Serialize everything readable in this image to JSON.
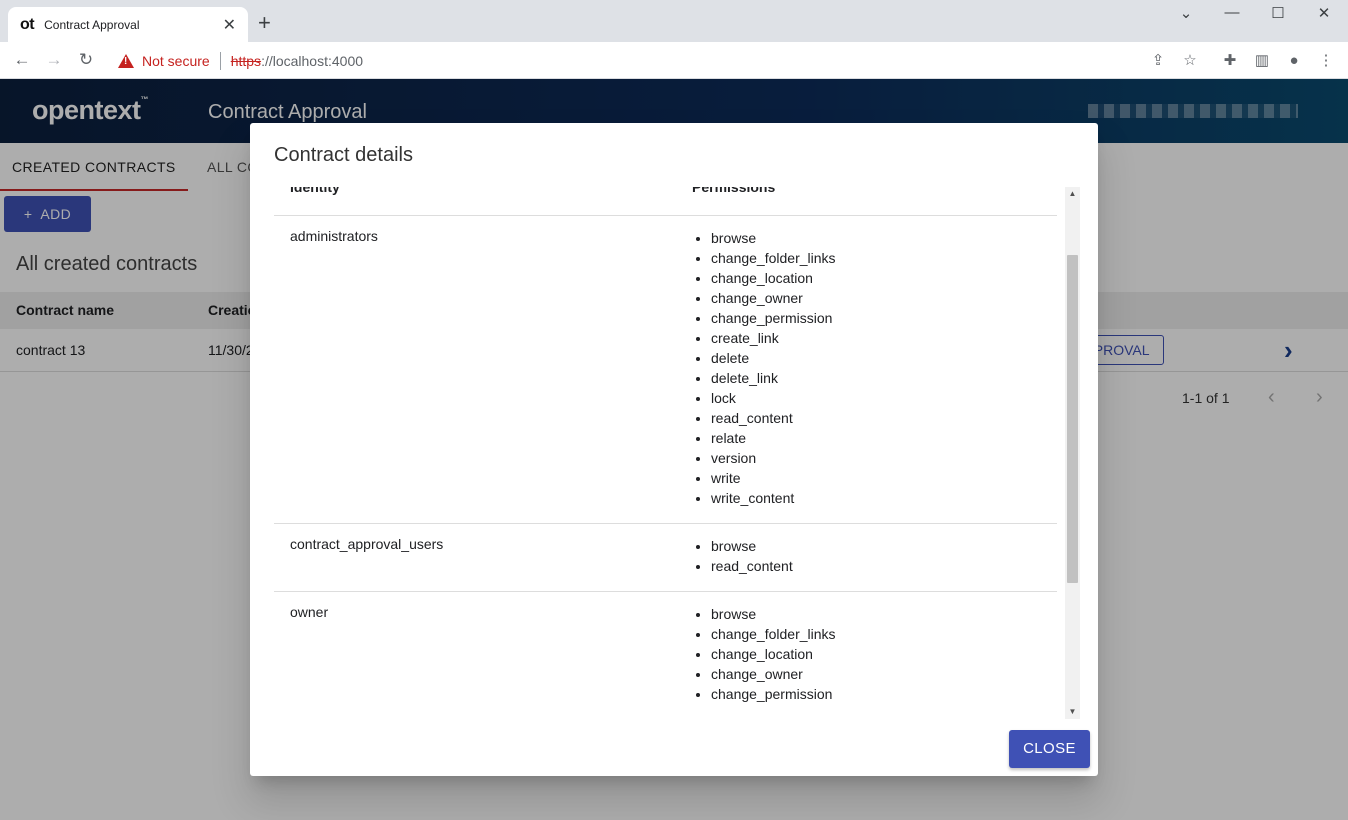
{
  "browser": {
    "tab_favicon": "ot",
    "tab_title": "Contract Approval",
    "tab_close": "✕",
    "new_tab": "+",
    "not_secure": "Not secure",
    "url_scheme": "https",
    "url_rest": "://localhost:4000"
  },
  "app": {
    "brand": "opentext",
    "brand_tm": "™",
    "title": "Contract Approval",
    "tabs": [
      {
        "label": "CREATED CONTRACTS"
      },
      {
        "label": "ALL CO"
      }
    ],
    "add_label": "ADD",
    "list_title": "All created contracts",
    "table": {
      "columns": [
        "Contract name",
        "Creatio"
      ],
      "rows": [
        {
          "name": "contract 13",
          "created": "11/30/2",
          "action": "PPROVAL"
        }
      ]
    },
    "pager": "1-1 of 1"
  },
  "dialog": {
    "title": "Contract details",
    "columns": {
      "identity": "Identity",
      "permissions": "Permissions"
    },
    "rows": [
      {
        "identity": "administrators",
        "permissions": [
          "browse",
          "change_folder_links",
          "change_location",
          "change_owner",
          "change_permission",
          "create_link",
          "delete",
          "delete_link",
          "lock",
          "read_content",
          "relate",
          "version",
          "write",
          "write_content"
        ]
      },
      {
        "identity": "contract_approval_users",
        "permissions": [
          "browse",
          "read_content"
        ]
      },
      {
        "identity": "owner",
        "permissions": [
          "browse",
          "change_folder_links",
          "change_location",
          "change_owner",
          "change_permission"
        ]
      }
    ],
    "close_label": "CLOSE"
  }
}
